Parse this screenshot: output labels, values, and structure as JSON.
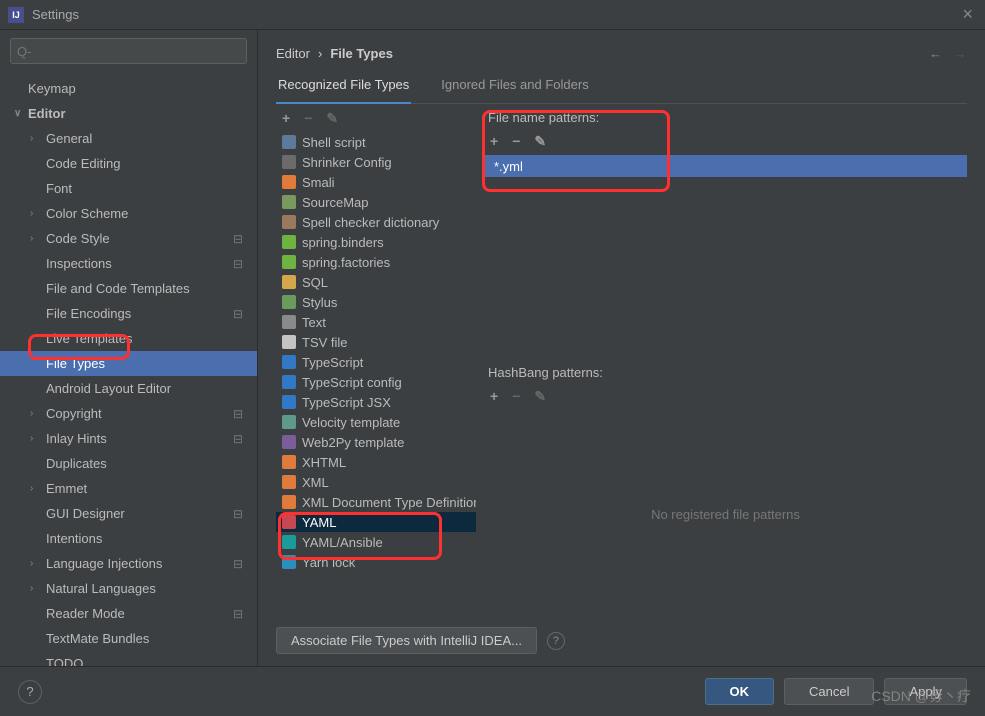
{
  "window": {
    "title": "Settings"
  },
  "search": {
    "placeholder": "Q-"
  },
  "tree": {
    "items": [
      {
        "label": "Keymap",
        "level": 0,
        "bold": false,
        "chev": "",
        "gear": false,
        "selected": false
      },
      {
        "label": "Editor",
        "level": 0,
        "bold": true,
        "chev": "v",
        "gear": false,
        "selected": false
      },
      {
        "label": "General",
        "level": 1,
        "bold": false,
        "chev": ">",
        "gear": false,
        "selected": false
      },
      {
        "label": "Code Editing",
        "level": 2,
        "bold": false,
        "chev": "",
        "gear": false,
        "selected": false
      },
      {
        "label": "Font",
        "level": 2,
        "bold": false,
        "chev": "",
        "gear": false,
        "selected": false
      },
      {
        "label": "Color Scheme",
        "level": 1,
        "bold": false,
        "chev": ">",
        "gear": false,
        "selected": false
      },
      {
        "label": "Code Style",
        "level": 1,
        "bold": false,
        "chev": ">",
        "gear": true,
        "selected": false
      },
      {
        "label": "Inspections",
        "level": 2,
        "bold": false,
        "chev": "",
        "gear": true,
        "selected": false
      },
      {
        "label": "File and Code Templates",
        "level": 2,
        "bold": false,
        "chev": "",
        "gear": false,
        "selected": false
      },
      {
        "label": "File Encodings",
        "level": 2,
        "bold": false,
        "chev": "",
        "gear": true,
        "selected": false
      },
      {
        "label": "Live Templates",
        "level": 2,
        "bold": false,
        "chev": "",
        "gear": false,
        "selected": false
      },
      {
        "label": "File Types",
        "level": 2,
        "bold": false,
        "chev": "",
        "gear": false,
        "selected": true
      },
      {
        "label": "Android Layout Editor",
        "level": 2,
        "bold": false,
        "chev": "",
        "gear": false,
        "selected": false
      },
      {
        "label": "Copyright",
        "level": 1,
        "bold": false,
        "chev": ">",
        "gear": true,
        "selected": false
      },
      {
        "label": "Inlay Hints",
        "level": 1,
        "bold": false,
        "chev": ">",
        "gear": true,
        "selected": false
      },
      {
        "label": "Duplicates",
        "level": 2,
        "bold": false,
        "chev": "",
        "gear": false,
        "selected": false
      },
      {
        "label": "Emmet",
        "level": 1,
        "bold": false,
        "chev": ">",
        "gear": false,
        "selected": false
      },
      {
        "label": "GUI Designer",
        "level": 2,
        "bold": false,
        "chev": "",
        "gear": true,
        "selected": false
      },
      {
        "label": "Intentions",
        "level": 2,
        "bold": false,
        "chev": "",
        "gear": false,
        "selected": false
      },
      {
        "label": "Language Injections",
        "level": 1,
        "bold": false,
        "chev": ">",
        "gear": true,
        "selected": false
      },
      {
        "label": "Natural Languages",
        "level": 1,
        "bold": false,
        "chev": ">",
        "gear": false,
        "selected": false
      },
      {
        "label": "Reader Mode",
        "level": 2,
        "bold": false,
        "chev": "",
        "gear": true,
        "selected": false
      },
      {
        "label": "TextMate Bundles",
        "level": 2,
        "bold": false,
        "chev": "",
        "gear": false,
        "selected": false
      },
      {
        "label": "TODO",
        "level": 2,
        "bold": false,
        "chev": "",
        "gear": false,
        "selected": false
      }
    ]
  },
  "breadcrumb": {
    "a": "Editor",
    "sep": "›",
    "b": "File Types"
  },
  "tabs": {
    "recognized": "Recognized File Types",
    "ignored": "Ignored Files and Folders"
  },
  "filetypes": [
    {
      "label": "Shell script",
      "color": "#5d7a9a"
    },
    {
      "label": "Shrinker Config",
      "color": "#6b6b6b"
    },
    {
      "label": "Smali",
      "color": "#e07b3c"
    },
    {
      "label": "SourceMap",
      "color": "#7a9a5d"
    },
    {
      "label": "Spell checker dictionary",
      "color": "#9a7a5d"
    },
    {
      "label": "spring.binders",
      "color": "#6db33f"
    },
    {
      "label": "spring.factories",
      "color": "#6db33f"
    },
    {
      "label": "SQL",
      "color": "#d4a74a"
    },
    {
      "label": "Stylus",
      "color": "#6b9a5d"
    },
    {
      "label": "Text",
      "color": "#8a8a8a"
    },
    {
      "label": "TSV file",
      "color": "#c4c4c4"
    },
    {
      "label": "TypeScript",
      "color": "#3178c6"
    },
    {
      "label": "TypeScript config",
      "color": "#3178c6"
    },
    {
      "label": "TypeScript JSX",
      "color": "#3178c6"
    },
    {
      "label": "Velocity template",
      "color": "#5d9a8a"
    },
    {
      "label": "Web2Py template",
      "color": "#7a5d9a"
    },
    {
      "label": "XHTML",
      "color": "#e07b3c"
    },
    {
      "label": "XML",
      "color": "#e07b3c"
    },
    {
      "label": "XML Document Type Definition",
      "color": "#e07b3c"
    },
    {
      "label": "YAML",
      "color": "#c74851",
      "selected": true
    },
    {
      "label": "YAML/Ansible",
      "color": "#1a9b9b"
    },
    {
      "label": "Yarn lock",
      "color": "#2c8ebb"
    }
  ],
  "patterns": {
    "label": "File name patterns:",
    "items": [
      "*.yml"
    ]
  },
  "hashbang": {
    "label": "HashBang patterns:",
    "empty": "No registered file patterns"
  },
  "associate": {
    "label": "Associate File Types with IntelliJ IDEA..."
  },
  "buttons": {
    "ok": "OK",
    "cancel": "Cancel",
    "apply": "Apply"
  },
  "watermark": "CSDN @毋丶疗"
}
